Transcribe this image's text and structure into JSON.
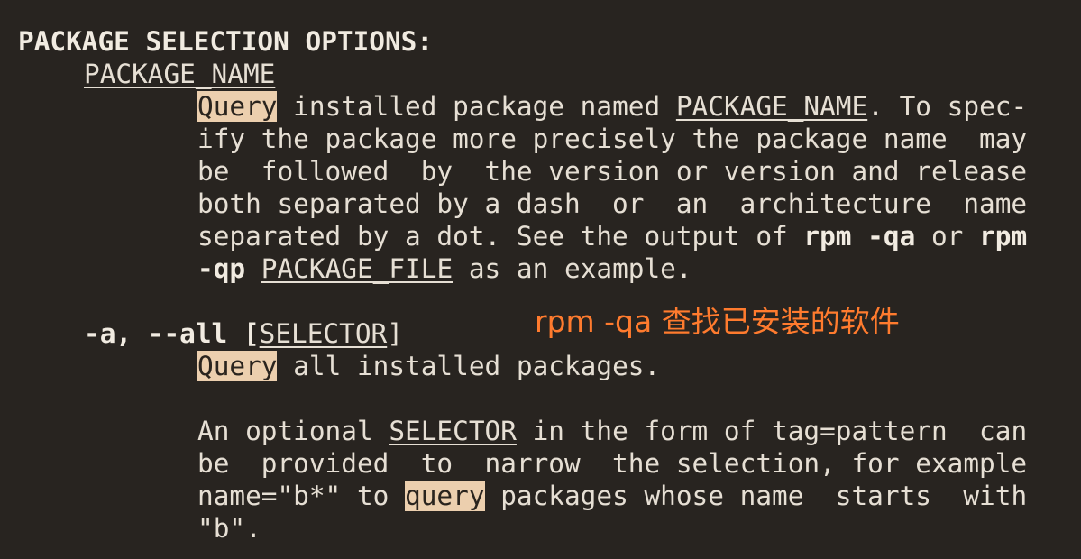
{
  "section_heading": "PACKAGE SELECTION OPTIONS:",
  "package_name_option": "PACKAGE_NAME",
  "pkgname_desc": {
    "l1_query": "Query",
    "l1_text": " installed package named ",
    "l1_arg": "PACKAGE_NAME",
    "l1_tail": ". To spec-",
    "l2": "ify the package more precisely the package name  may",
    "l3": "be  followed  by  the version or version and release",
    "l4": "both separated by a dash  or  an  architecture  name",
    "l5_text": "separated by a dot. See the output of ",
    "l5_cmd1": "rpm -qa",
    "l5_mid": " or ",
    "l5_cmd2": "rpm",
    "l6_flag": "-qp",
    "l6_arg": "PACKAGE_FILE",
    "l6_tail": " as an example."
  },
  "all_option": {
    "flags": "-a, --all",
    "bracket_open": " [",
    "arg": "SELECTOR",
    "bracket_close": "]",
    "desc_query": "Query",
    "desc_text": " all installed packages.",
    "p2_l1_pre": "An optional ",
    "p2_l1_arg": "SELECTOR",
    "p2_l1_post": " in the form of tag=pattern  can",
    "p2_l2": "be  provided  to  narrow  the selection, for example",
    "p2_l3_pre": "name=\"b*\" to ",
    "p2_l3_query": "query",
    "p2_l3_post": " packages whose name  starts  with",
    "p2_l4": "\"b\"."
  },
  "annotation": "rpm -qa 查找已安装的软件",
  "colors": {
    "background": "#282420",
    "text": "#e6dfd4",
    "highlight": "#eccfae",
    "annotation": "#ff7b2e"
  }
}
